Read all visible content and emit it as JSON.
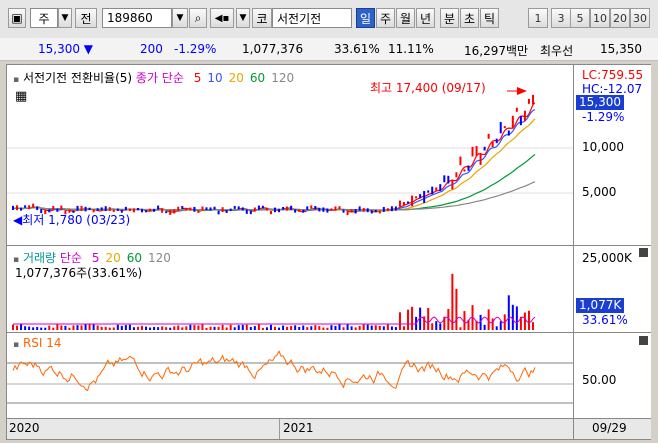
{
  "toolbar": {
    "market_label": "주",
    "type_label": "전",
    "code": "189860",
    "market_button": "코",
    "name": "서전기전",
    "periods": [
      "일",
      "주",
      "월",
      "년",
      "분",
      "초",
      "틱"
    ],
    "selected_period": "일",
    "intervals": [
      "1",
      "3",
      "5",
      "10",
      "20",
      "30"
    ]
  },
  "quote": {
    "price": "15,300 ▼",
    "change": "200",
    "change_pct": "-1.29%",
    "volume": "1,077,376",
    "vol_ratio": "33.61%",
    "turnover_pct": "11.11%",
    "amount": "16,297백만",
    "best_ask_label": "최우선",
    "best_ask": "15,350"
  },
  "price_panel": {
    "title": "서전기전 전환비율(5)",
    "legend_prefix": "종가 단순",
    "ma_labels": [
      "5",
      "10",
      "20",
      "60",
      "120"
    ],
    "ma_colors": [
      "#ff0000",
      "#3355ff",
      "#e6a700",
      "#009933",
      "#888888"
    ],
    "max_label": "최고 17,400 (09/17)",
    "min_label": "최저 1,780 (03/23)",
    "lc": "LC:759.55",
    "hc": "HC:-12.07",
    "price_tag": "15,300",
    "pct_tag": "-1.29%",
    "ticks": [
      "10,000",
      "5,000"
    ]
  },
  "volume_panel": {
    "title": "거래량",
    "legend_prefix": "단순",
    "ma_labels": [
      "5",
      "20",
      "60",
      "120"
    ],
    "ma_colors": [
      "#cc00cc",
      "#e6a700",
      "#009933",
      "#888888"
    ],
    "value": "1,077,376주(33.61%)",
    "tick": "25,000K",
    "vol_tag": "1,077K",
    "pct_tag": "33.61%"
  },
  "rsi_panel": {
    "title": "RSI 14",
    "tick": "50.00"
  },
  "x_axis": {
    "labels": [
      "2020",
      "2021"
    ],
    "date": "09/29"
  },
  "colors": {
    "up": "#ff0000",
    "down": "#0000ff",
    "rsi": "#ff6600",
    "tag_blue": "#1a3fd0"
  }
}
